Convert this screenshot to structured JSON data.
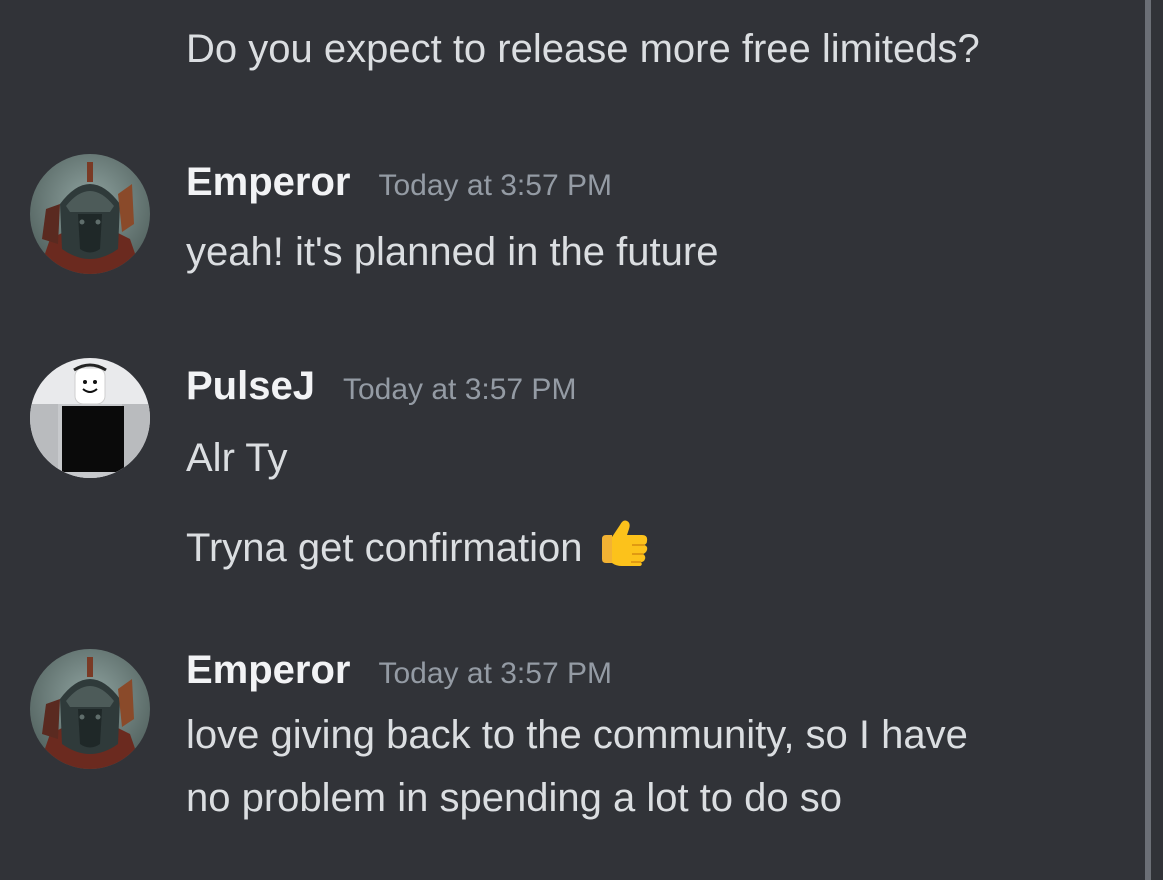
{
  "messages": [
    {
      "text": "Do you expect to release more free limiteds?"
    },
    {
      "author": "Emperor",
      "timestamp": "Today at 3:57 PM",
      "lines": [
        "yeah! it's planned in the future"
      ]
    },
    {
      "author": "PulseJ",
      "timestamp": "Today at 3:57 PM",
      "lines": [
        "Alr Ty",
        "Tryna get confirmation"
      ],
      "emoji": "thumbs-up"
    },
    {
      "author": "Emperor",
      "timestamp": "Today at 3:57 PM",
      "lines": [
        "love giving back to the community, so I have",
        "no problem in spending a lot to do so"
      ]
    }
  ],
  "colors": {
    "background": "#313338",
    "message_text": "#dbdee1",
    "username": "#f2f3f5",
    "timestamp": "#949ba4"
  }
}
